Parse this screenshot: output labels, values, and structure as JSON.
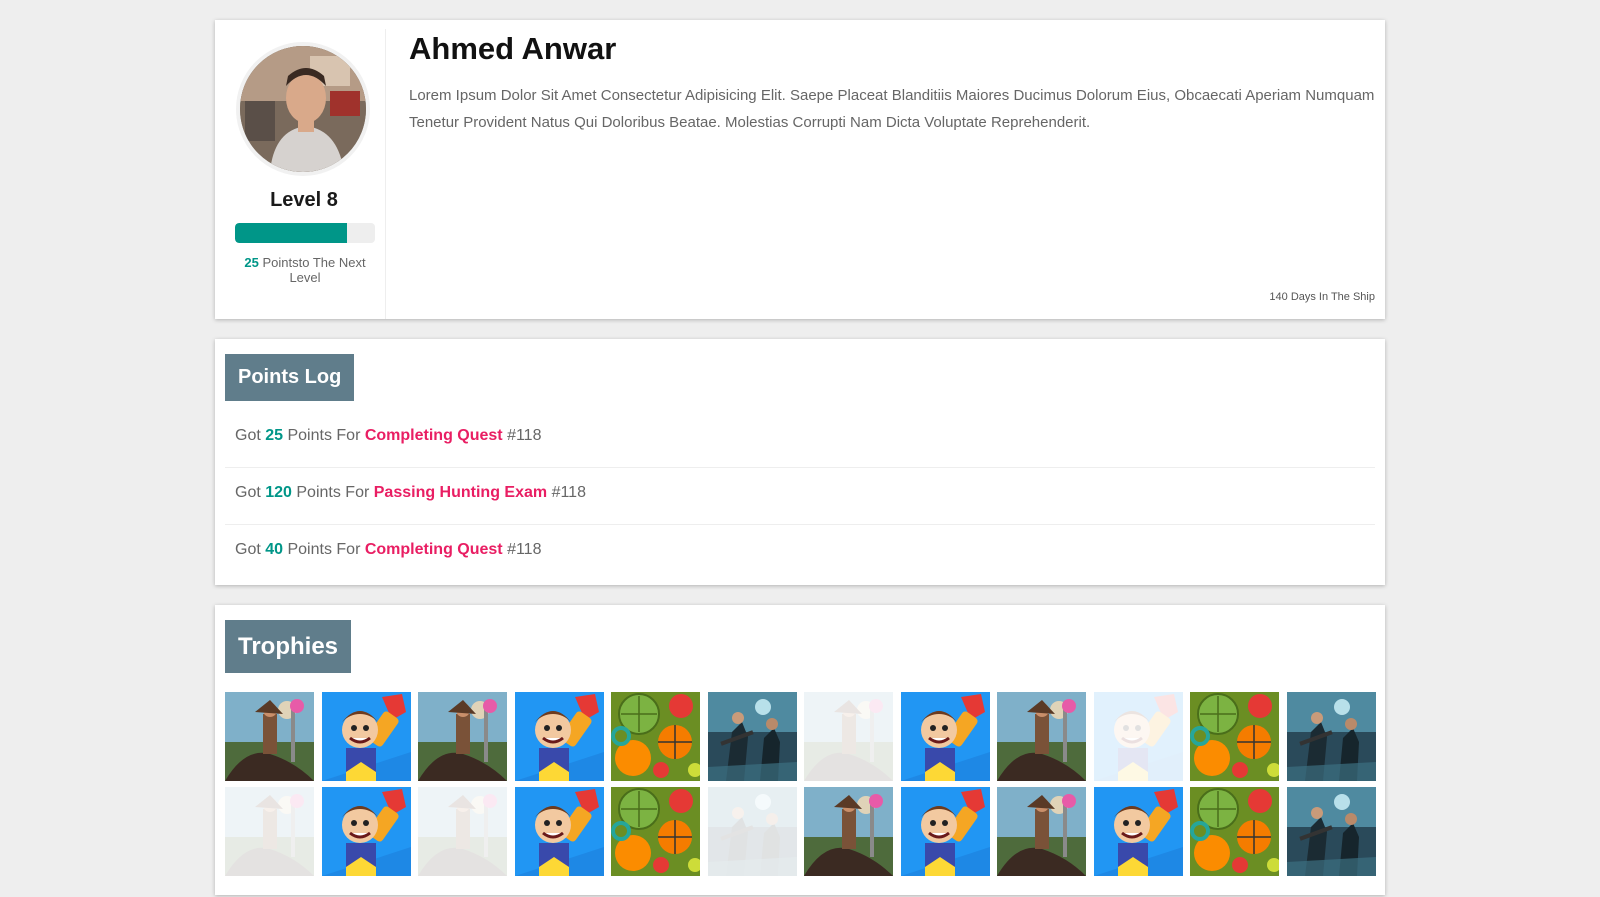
{
  "profile": {
    "name": "Ahmed Anwar",
    "bio": "Lorem Ipsum Dolor Sit Amet Consectetur Adipisicing Elit. Saepe Placeat Blanditiis Maiores Ducimus Dolorum Eius, Obcaecati Aperiam Numquam Tenetur Provident Natus Qui Doloribus Beatae. Molestias Corrupti Nam Dicta Voluptate Reprehenderit.",
    "level_label": "Level 8",
    "level_progress": 0.8,
    "next_points": "25",
    "next_suffix": " Pointsto The Next Level",
    "days": "140 Days In The Ship"
  },
  "points_log": {
    "title": "Points Log",
    "entries": [
      {
        "prefix": "Got ",
        "points": "25",
        "middle": " Points For ",
        "action": "Completing Quest",
        "ref": " #118"
      },
      {
        "prefix": "Got ",
        "points": "120",
        "middle": " Points For ",
        "action": "Passing Hunting Exam",
        "ref": " #118"
      },
      {
        "prefix": "Got ",
        "points": "40",
        "middle": " Points For ",
        "action": "Completing Quest",
        "ref": " #118"
      }
    ]
  },
  "trophies": {
    "title": "Trophies",
    "items": [
      {
        "icon": "warrior-icon",
        "locked": false
      },
      {
        "icon": "jetpack-hero-icon",
        "locked": false
      },
      {
        "icon": "warrior-icon",
        "locked": false
      },
      {
        "icon": "jetpack-hero-icon",
        "locked": false
      },
      {
        "icon": "sports-balls-icon",
        "locked": false
      },
      {
        "icon": "soldiers-icon",
        "locked": false
      },
      {
        "icon": "warrior-icon",
        "locked": true
      },
      {
        "icon": "jetpack-hero-icon",
        "locked": false
      },
      {
        "icon": "warrior-icon",
        "locked": false
      },
      {
        "icon": "jetpack-hero-icon",
        "locked": true
      },
      {
        "icon": "sports-balls-icon",
        "locked": false
      },
      {
        "icon": "soldiers-icon",
        "locked": false
      },
      {
        "icon": "warrior-icon",
        "locked": true
      },
      {
        "icon": "jetpack-hero-icon",
        "locked": false
      },
      {
        "icon": "warrior-icon",
        "locked": true
      },
      {
        "icon": "jetpack-hero-icon",
        "locked": false
      },
      {
        "icon": "sports-balls-icon",
        "locked": false
      },
      {
        "icon": "soldiers-icon",
        "locked": true
      },
      {
        "icon": "warrior-icon",
        "locked": false
      },
      {
        "icon": "jetpack-hero-icon",
        "locked": false
      },
      {
        "icon": "warrior-icon",
        "locked": false
      },
      {
        "icon": "jetpack-hero-icon",
        "locked": false
      },
      {
        "icon": "sports-balls-icon",
        "locked": false
      },
      {
        "icon": "soldiers-icon",
        "locked": false
      }
    ]
  },
  "colors": {
    "accent": "#009688",
    "highlight": "#e91e63",
    "section_header": "#607d8b",
    "background": "#eeeeee"
  }
}
